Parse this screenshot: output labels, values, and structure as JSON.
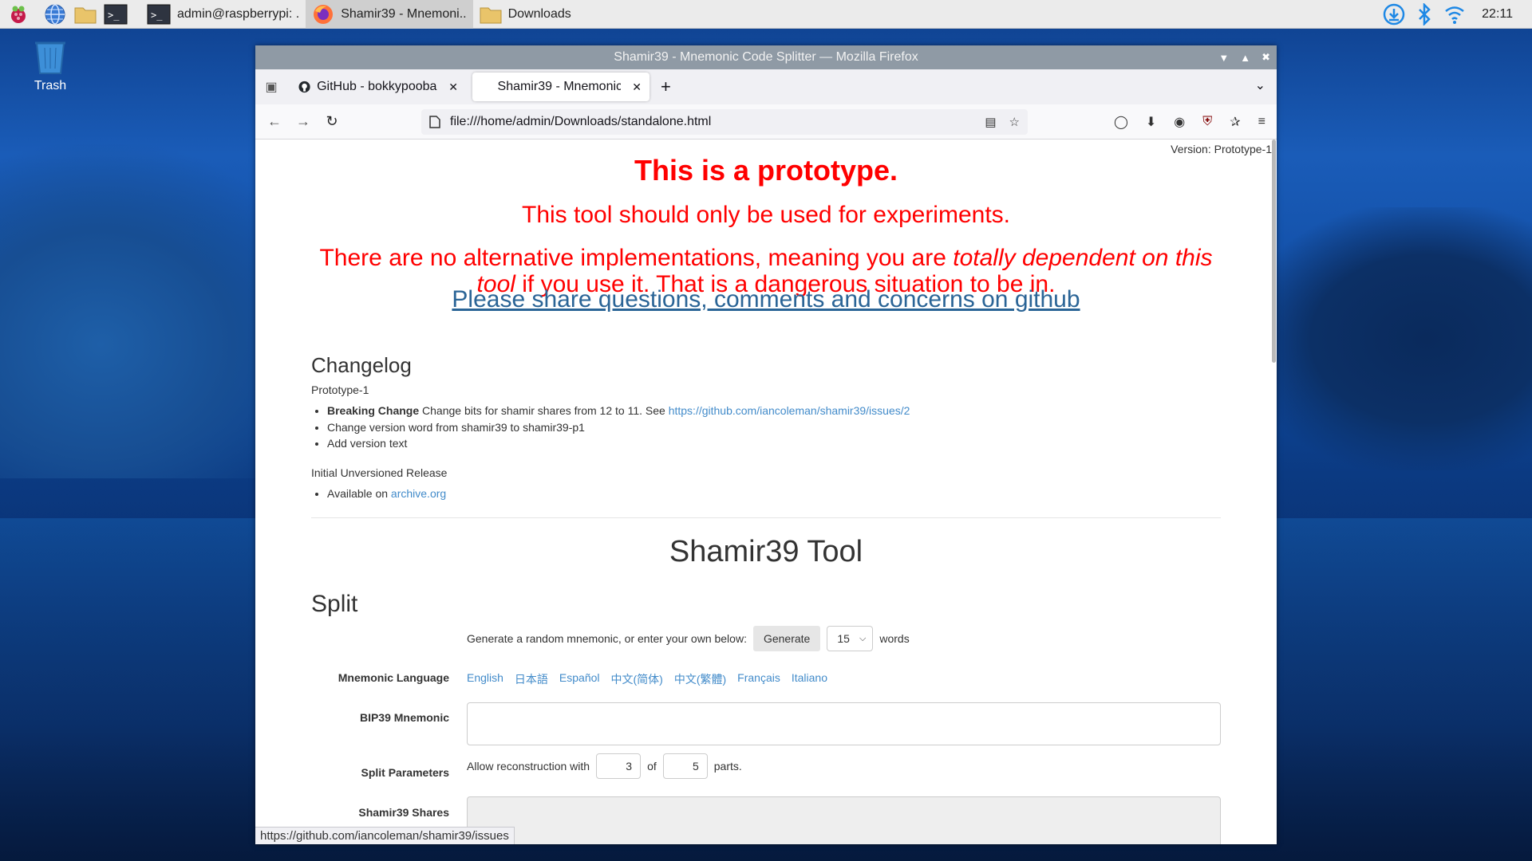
{
  "taskbar": {
    "tasks": [
      {
        "label": "admin@raspberrypi: ."
      },
      {
        "label": "Shamir39 - Mnemoni.."
      },
      {
        "label": "Downloads"
      }
    ],
    "clock": "22:11"
  },
  "desktop": {
    "trash_label": "Trash"
  },
  "window": {
    "title": "Shamir39 - Mnemonic Code Splitter — Mozilla Firefox",
    "tabs": [
      {
        "title": "GitHub - bokkypoobah/"
      },
      {
        "title": "Shamir39 - Mnemonic C"
      }
    ],
    "url": "file:///home/admin/Downloads/standalone.html"
  },
  "page": {
    "version": "Version: Prototype-1",
    "prototype": "This is a prototype.",
    "experiments": "This tool should only be used for experiments.",
    "warning_1": "There are no alternative implementations, meaning you are ",
    "warning_italic_1": "totally dependent on this",
    "warning_italic_2": "tool",
    "warning_2": " if you use it. That is a dangerous situation to be in.",
    "share_link": "Please share questions, comments and concerns on github",
    "changelog_heading": "Changelog",
    "prototype1_label": "Prototype-1",
    "change_items": {
      "breaking_bold": "Breaking Change",
      "breaking_text": " Change bits for shamir shares from 12 to 11. See ",
      "breaking_link": "https://github.com/iancoleman/shamir39/issues/2",
      "version_word": "Change version word from shamir39 to shamir39-p1",
      "version_text": "Add version text"
    },
    "initial_release": "Initial Unversioned Release",
    "available_text": "Available on ",
    "available_link": "archive.org",
    "tool_heading": "Shamir39 Tool",
    "split_heading": "Split",
    "generate_text": "Generate a random mnemonic, or enter your own below:",
    "generate_button": "Generate",
    "word_count": "15",
    "words_label": "words",
    "mnemonic_language_label": "Mnemonic Language",
    "languages": [
      "English",
      "日本語",
      "Español",
      "中文(简体)",
      "中文(繁體)",
      "Français",
      "Italiano"
    ],
    "bip39_label": "BIP39 Mnemonic",
    "split_params_label": "Split Parameters",
    "allow_text": "Allow reconstruction with",
    "threshold": "3",
    "of_text": "of",
    "total_parts": "5",
    "parts_text": "parts.",
    "shares_label": "Shamir39 Shares"
  },
  "statusbar": {
    "url": "https://github.com/iancoleman/shamir39/issues"
  }
}
